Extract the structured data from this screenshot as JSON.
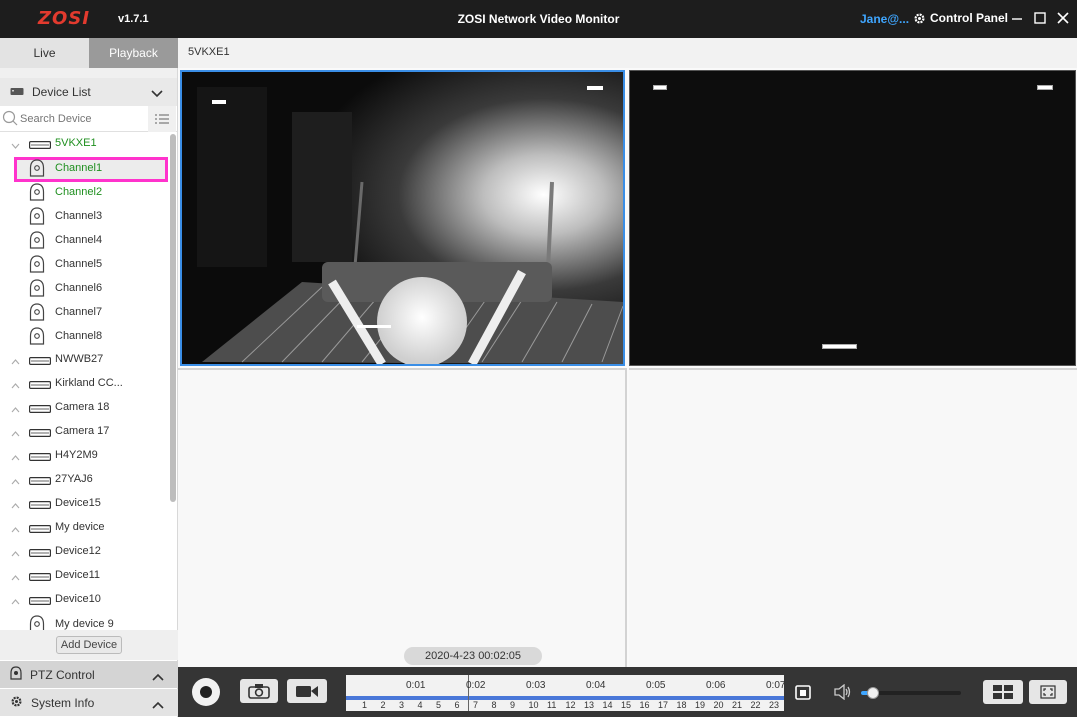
{
  "app": {
    "brand": "ZOSI",
    "version": "v1.7.1",
    "title": "ZOSI Network Video Monitor",
    "user": "Jane@...",
    "control_panel": "Control Panel",
    "brand_color": "#e23a2e",
    "accent_color": "#3fa6ff"
  },
  "tabs": [
    {
      "label": "Live",
      "active": false
    },
    {
      "label": "Playback",
      "active": true
    }
  ],
  "breadcrumb": "5VKXE1",
  "sidebar": {
    "device_list_label": "Device List",
    "search_placeholder": "Search Device",
    "tree": [
      {
        "type": "device",
        "name": "5VKXE1",
        "expanded": true,
        "highlight": true
      },
      {
        "type": "channel",
        "name": "Channel1",
        "selected": true,
        "highlight": true
      },
      {
        "type": "channel",
        "name": "Channel2",
        "highlight": true
      },
      {
        "type": "channel",
        "name": "Channel3"
      },
      {
        "type": "channel",
        "name": "Channel4"
      },
      {
        "type": "channel",
        "name": "Channel5"
      },
      {
        "type": "channel",
        "name": "Channel6"
      },
      {
        "type": "channel",
        "name": "Channel7"
      },
      {
        "type": "channel",
        "name": "Channel8"
      },
      {
        "type": "device",
        "name": "NWWB27"
      },
      {
        "type": "device",
        "name": "Kirkland CC..."
      },
      {
        "type": "device",
        "name": "Camera 18"
      },
      {
        "type": "device",
        "name": "Camera 17"
      },
      {
        "type": "device",
        "name": "H4Y2M9"
      },
      {
        "type": "device",
        "name": "27YAJ6"
      },
      {
        "type": "device",
        "name": "Device15"
      },
      {
        "type": "device",
        "name": "My device"
      },
      {
        "type": "device",
        "name": "Device12"
      },
      {
        "type": "device",
        "name": "Device11"
      },
      {
        "type": "device",
        "name": "Device10"
      },
      {
        "type": "channel",
        "name": "My device 9"
      }
    ],
    "add_device": "Add Device",
    "ptz_control": "PTZ Control",
    "system_info": "System Info"
  },
  "playback": {
    "datetime": "2020-4-23 00:02:05",
    "time_labels": [
      "0:01",
      "0:02",
      "0:03",
      "0:04",
      "0:05",
      "0:06",
      "0:07"
    ],
    "channel_numbers": [
      "1",
      "2",
      "3",
      "4",
      "5",
      "6",
      "7",
      "8",
      "9",
      "10",
      "11",
      "12",
      "13",
      "14",
      "15",
      "16",
      "17",
      "18",
      "19",
      "20",
      "21",
      "22",
      "23"
    ],
    "volume": 0.12
  }
}
